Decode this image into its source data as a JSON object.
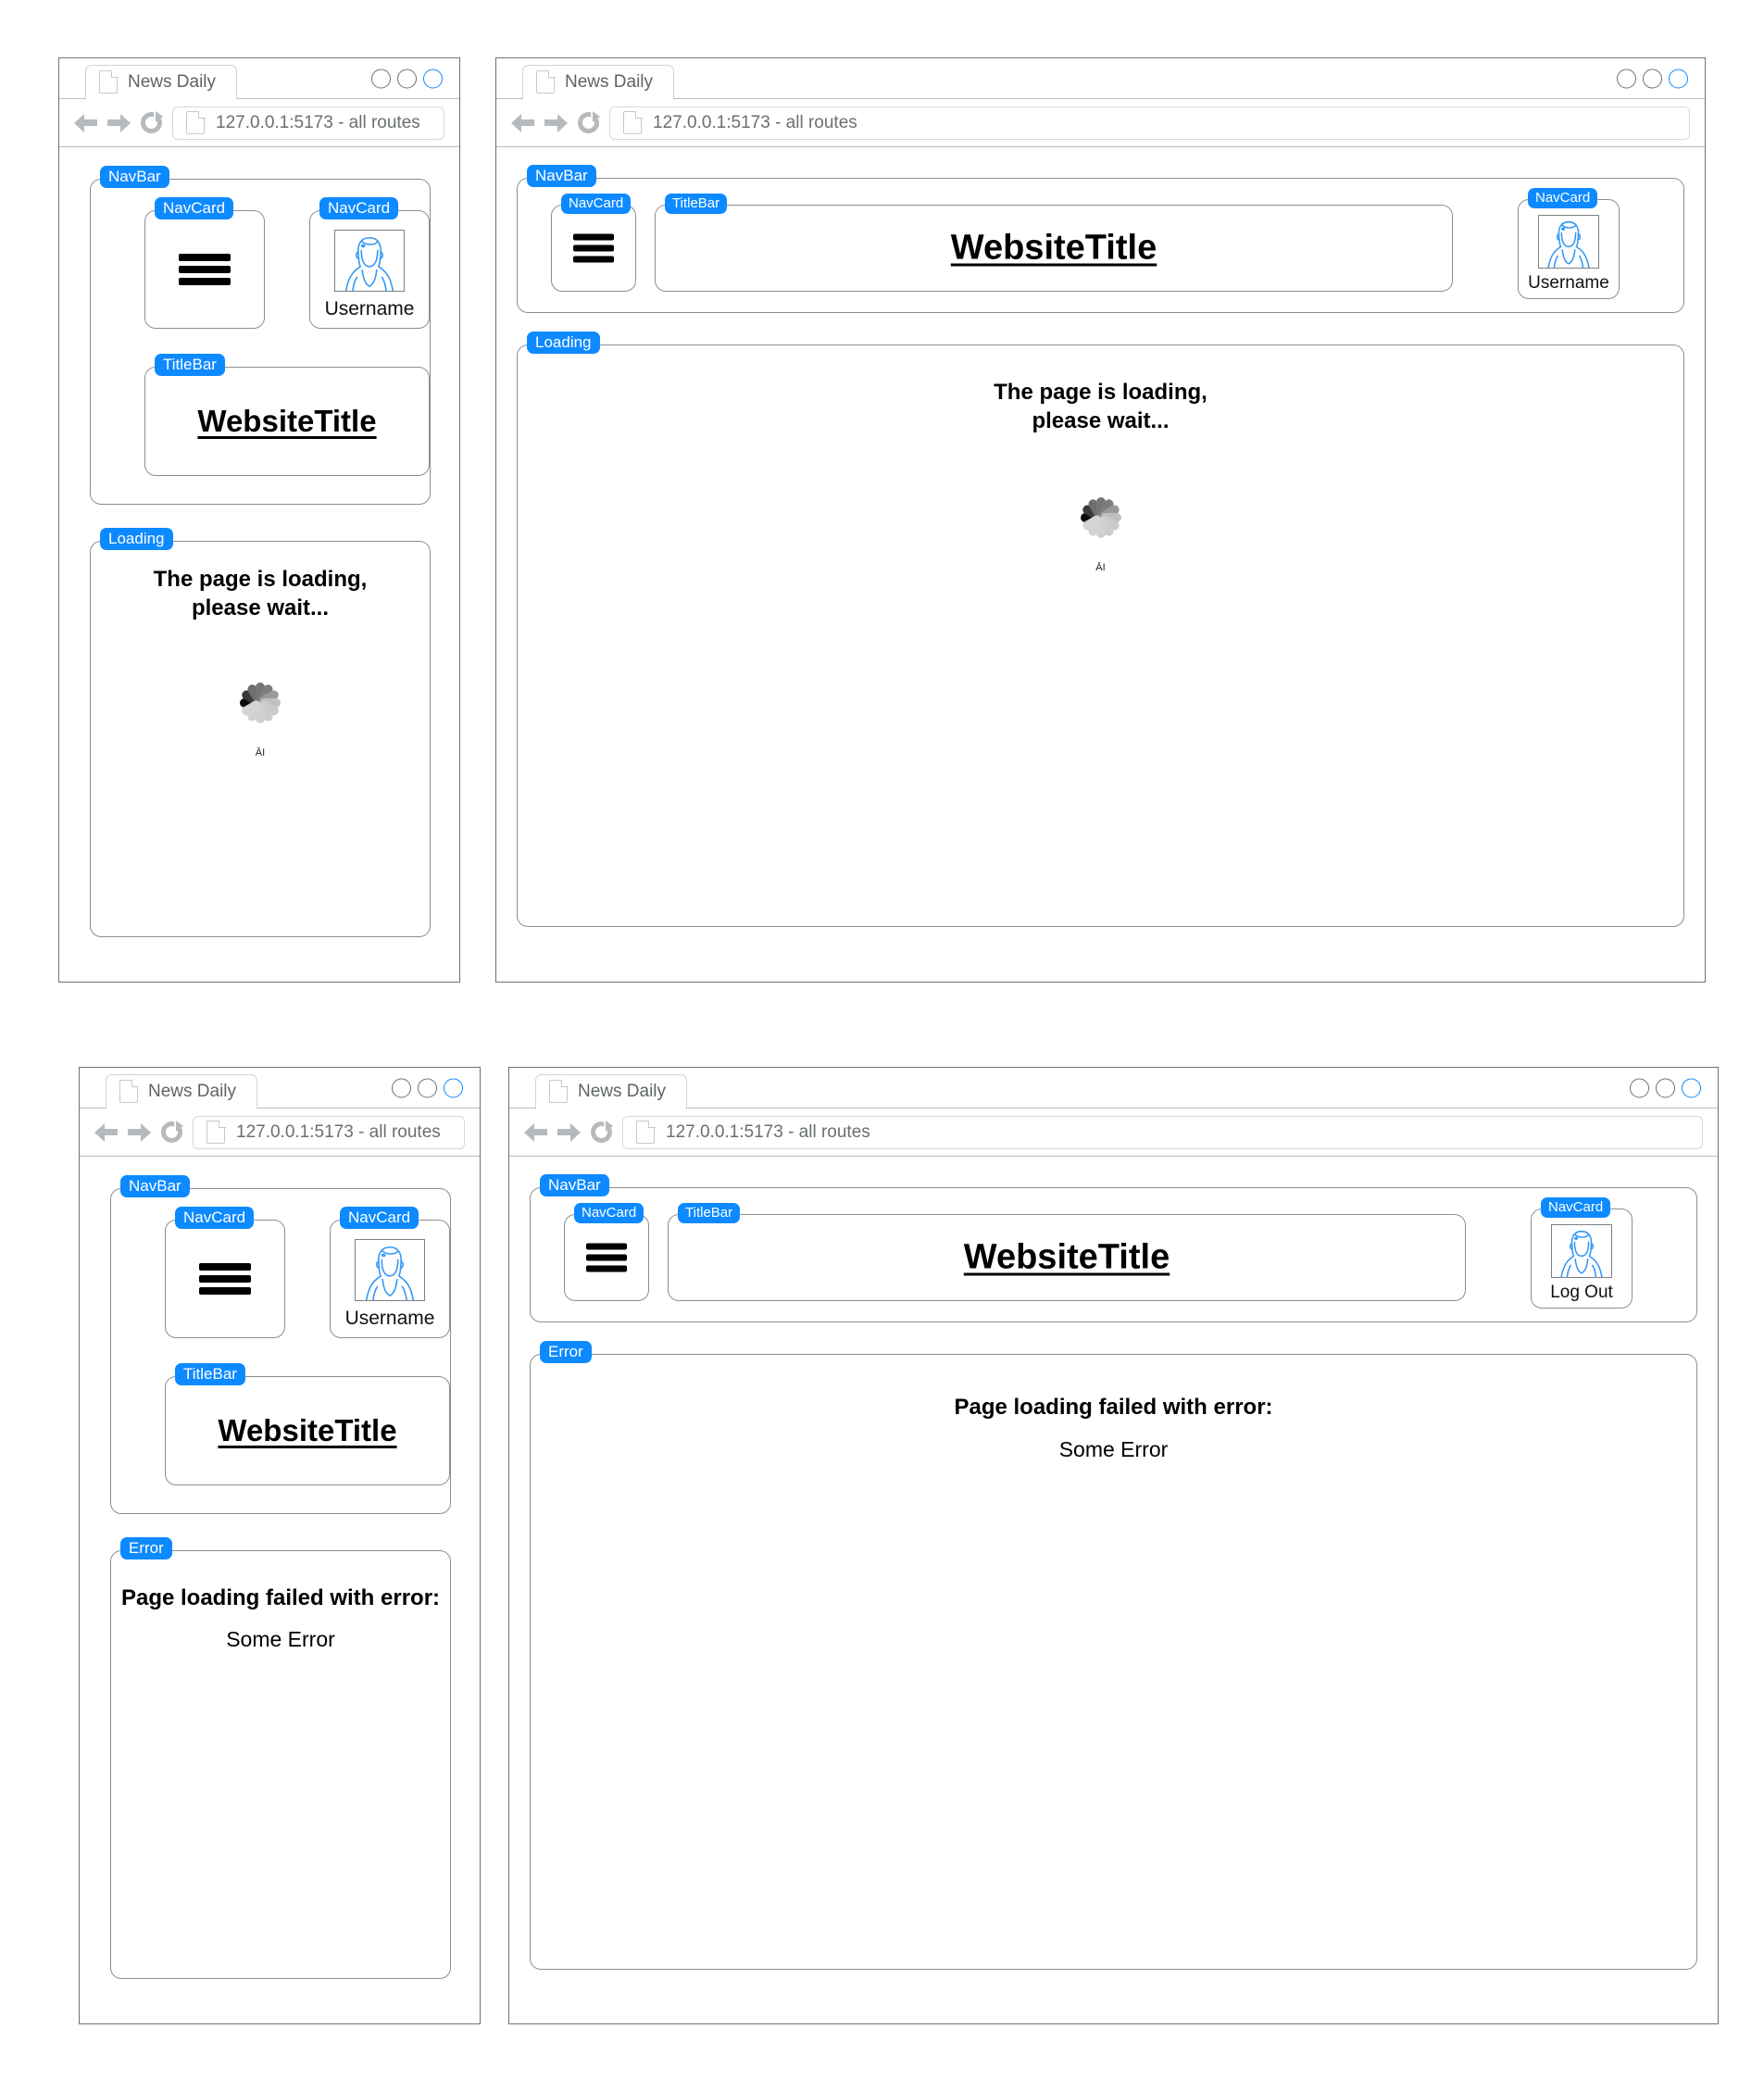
{
  "browser": {
    "tab_title": "News Daily",
    "url": "127.0.0.1:5173 - all routes",
    "url_wide": "127.0.0.1:5173  - all routes",
    "window_buttons": [
      "minimize-circle",
      "maximize-circle",
      "close-circle"
    ],
    "icons": {
      "page": "page-icon",
      "back": "back-arrow-icon",
      "forward": "forward-arrow-icon",
      "reload": "reload-icon"
    }
  },
  "annotation_labels": {
    "navbar": "NavBar",
    "navcard": "NavCard",
    "titlebar": "TitleBar",
    "loading": "Loading",
    "error": "Error"
  },
  "components": {
    "menu_icon": "hamburger-menu-icon",
    "avatar_icon": "user-avatar-icon",
    "username": "Username",
    "logout": "Log Out",
    "website_title": "WebsiteTitle",
    "loading_line1": "The page is loading,",
    "loading_line2": "please wait...",
    "spinner_caption": "ĀI",
    "error_heading": "Page loading failed with error:",
    "error_detail": "Some Error"
  },
  "colors": {
    "accent_blue": "#0d8aff",
    "frame_gray": "#6e7276",
    "box_gray": "#8b8f92",
    "text_gray": "#6a6f72"
  },
  "panels": [
    {
      "id": "p1",
      "variant": "loading",
      "layout": "narrow",
      "user_label": "Username"
    },
    {
      "id": "p2",
      "variant": "loading",
      "layout": "wide",
      "user_label": "Username"
    },
    {
      "id": "p3",
      "variant": "error",
      "layout": "narrow",
      "user_label": "Username"
    },
    {
      "id": "p4",
      "variant": "error",
      "layout": "wide",
      "user_label": "Log Out"
    }
  ]
}
